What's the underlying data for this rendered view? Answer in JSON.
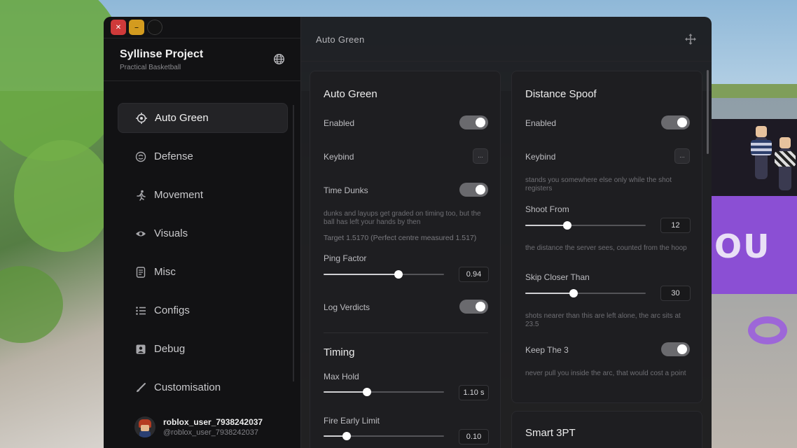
{
  "window": {
    "brand_title": "Syllinse Project",
    "brand_subtitle": "Practical Basketball",
    "main_title": "Auto Green"
  },
  "sidebar": {
    "items": [
      {
        "label": "Auto Green",
        "icon": "crosshair-icon",
        "active": true
      },
      {
        "label": "Defense",
        "icon": "shield-face-icon",
        "active": false
      },
      {
        "label": "Movement",
        "icon": "running-person-icon",
        "active": false
      },
      {
        "label": "Visuals",
        "icon": "eye-icon",
        "active": false
      },
      {
        "label": "Misc",
        "icon": "document-icon",
        "active": false
      },
      {
        "label": "Configs",
        "icon": "list-icon",
        "active": false
      },
      {
        "label": "Debug",
        "icon": "id-card-icon",
        "active": false
      },
      {
        "label": "Customisation",
        "icon": "brush-icon",
        "active": false
      }
    ]
  },
  "user": {
    "name": "roblox_user_7938242037",
    "handle": "@roblox_user_7938242037"
  },
  "auto_green": {
    "title": "Auto Green",
    "enabled_label": "Enabled",
    "enabled": true,
    "keybind_label": "Keybind",
    "keybind_value": "...",
    "time_dunks_label": "Time Dunks",
    "time_dunks": true,
    "time_dunks_hint": "dunks and layups get graded on timing too, but the ball has left your hands by then",
    "target_text": "Target 1.5170 (Perfect centre measured 1.517)",
    "ping_factor_label": "Ping Factor",
    "ping_factor_value": "0.94",
    "ping_factor_fraction": 0.62,
    "log_verdicts_label": "Log Verdicts",
    "log_verdicts": true
  },
  "timing": {
    "title": "Timing",
    "max_hold_label": "Max Hold",
    "max_hold_value": "1.10 s",
    "max_hold_fraction": 0.36,
    "fire_early_label": "Fire Early Limit",
    "fire_early_value": "0.10",
    "fire_early_fraction": 0.19
  },
  "distance_spoof": {
    "title": "Distance Spoof",
    "enabled_label": "Enabled",
    "enabled": true,
    "keybind_label": "Keybind",
    "keybind_value": "...",
    "keybind_hint": "stands you somewhere else only while the shot registers",
    "shoot_from_label": "Shoot From",
    "shoot_from_value": "12",
    "shoot_from_fraction": 0.35,
    "shoot_from_hint": "the distance the server sees, counted from the hoop",
    "skip_closer_label": "Skip Closer Than",
    "skip_closer_value": "30",
    "skip_closer_fraction": 0.4,
    "skip_closer_hint": "shots nearer than this are left alone, the arc sits at 23.5",
    "keep_the_3_label": "Keep The 3",
    "keep_the_3": true,
    "keep_the_3_hint": "never pull you inside the arc, that would cost a point"
  },
  "smart_3pt": {
    "title": "Smart 3PT"
  },
  "colors": {
    "accent": "#ffffff",
    "toggle_on": "#6a6a6e",
    "close": "#cf3a3a",
    "minimize": "#d39b1f"
  }
}
